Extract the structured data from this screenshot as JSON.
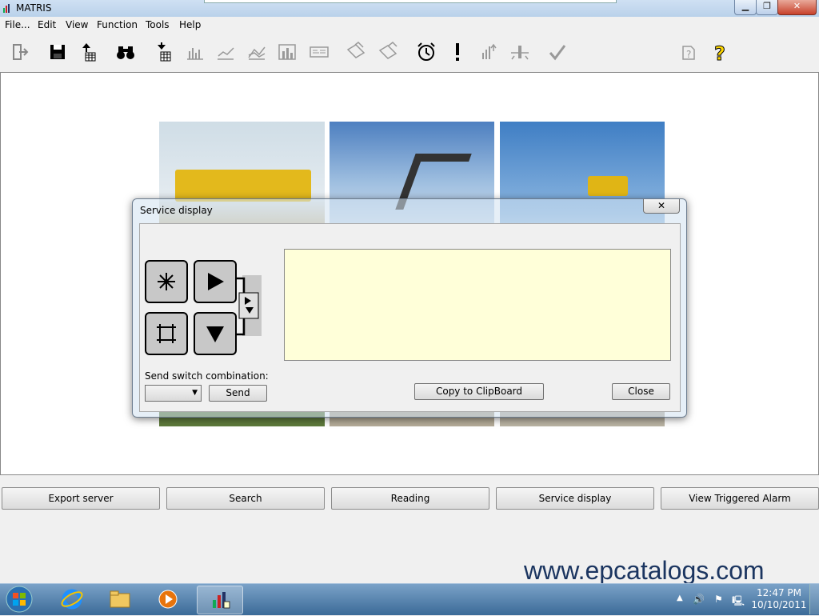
{
  "window": {
    "title": "MATRIS"
  },
  "menu": [
    "File...",
    "Edit",
    "View",
    "Function",
    "Tools",
    "Help"
  ],
  "bottom_buttons": [
    "Export server",
    "Search",
    "Reading",
    "Service display",
    "View Triggered Alarm"
  ],
  "dialog": {
    "title": "Service display",
    "close_x": "✕",
    "send_label": "Send switch combination:",
    "combo_value": "",
    "send_button": "Send",
    "copy_button": "Copy to ClipBoard",
    "close_button": "Close",
    "output_text": ""
  },
  "watermark": "www.epcatalogs.com",
  "taskbar": {
    "time": "12:47 PM",
    "date": "10/10/2011"
  },
  "colors": {
    "output_bg": "#ffffd9",
    "taskbar": "#3b6a97",
    "watermark": "#1b3560"
  }
}
